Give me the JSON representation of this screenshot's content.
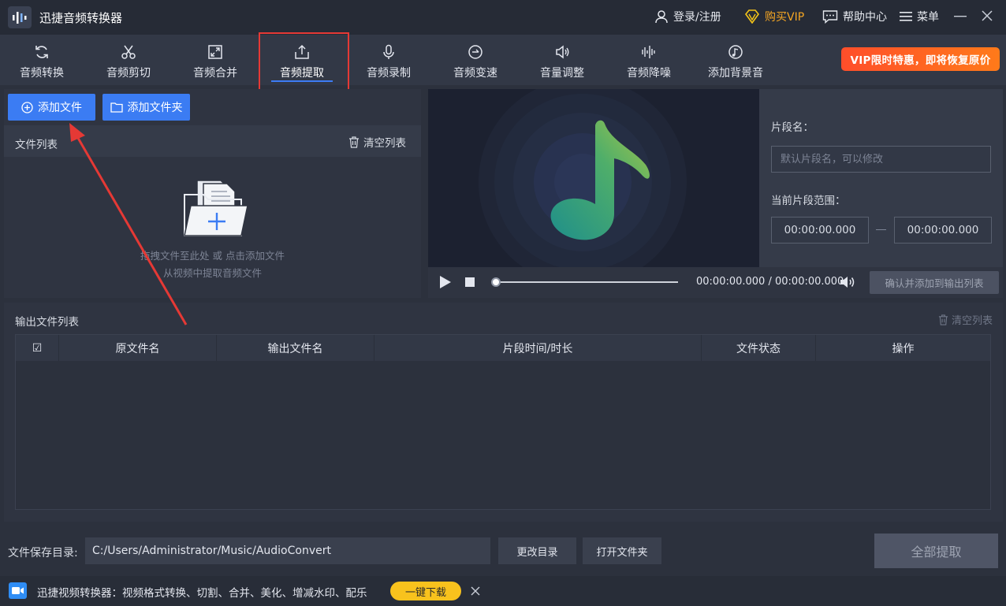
{
  "app": {
    "title": "迅捷音频转换器"
  },
  "titlebar": {
    "login_label": "登录/注册",
    "vip_label": "购买VIP",
    "help_label": "帮助中心",
    "menu_label": "菜单"
  },
  "toolbar": {
    "items": [
      {
        "label": "音频转换",
        "icon": "refresh-icon"
      },
      {
        "label": "音频剪切",
        "icon": "scissors-icon"
      },
      {
        "label": "音频合并",
        "icon": "merge-icon"
      },
      {
        "label": "音频提取",
        "icon": "extract-icon",
        "active": true
      },
      {
        "label": "音频录制",
        "icon": "microphone-icon"
      },
      {
        "label": "音频变速",
        "icon": "speed-icon"
      },
      {
        "label": "音量调整",
        "icon": "volume-icon"
      },
      {
        "label": "音频降噪",
        "icon": "waveform-icon"
      },
      {
        "label": "添加背景音",
        "icon": "music-disc-icon"
      }
    ],
    "vip_banner": "VIP限时特惠，即将恢复原价"
  },
  "file_panel": {
    "add_file": "添加文件",
    "add_folder": "添加文件夹",
    "list_title": "文件列表",
    "clear_list": "清空列表",
    "hint_line1": "拖拽文件至此处 或 点击添加文件",
    "hint_line2": "从视频中提取音频文件"
  },
  "segment": {
    "name_label": "片段名：",
    "name_placeholder": "默认片段名，可以修改",
    "range_label": "当前片段范围：",
    "start": "00:00:00.000",
    "end": "00:00:00.000"
  },
  "player": {
    "current_time": "00:00:00.000",
    "separator": " / ",
    "total_time": "00:00:00.000",
    "progress": 0,
    "confirm_add": "确认并添加到输出列表"
  },
  "output": {
    "title": "输出文件列表",
    "clear_list": "清空列表",
    "columns": [
      "原文件名",
      "输出文件名",
      "片段时间/时长",
      "文件状态",
      "操作"
    ],
    "check_symbol": "☑"
  },
  "bottom": {
    "save_dir_label": "文件保存目录:",
    "save_dir_value": "C:/Users/Administrator/Music/AudioConvert",
    "change_dir": "更改目录",
    "open_folder": "打开文件夹",
    "extract_all": "全部提取"
  },
  "promo": {
    "text": "迅捷视频转换器：视频格式转换、切割、合并、美化、增减水印、配乐",
    "download": "一键下载"
  },
  "colors": {
    "accent_blue": "#3b7cf3",
    "vip_gold": "#f5a623",
    "annotation_red": "#e53935",
    "promo_yellow": "#f8c21d"
  }
}
